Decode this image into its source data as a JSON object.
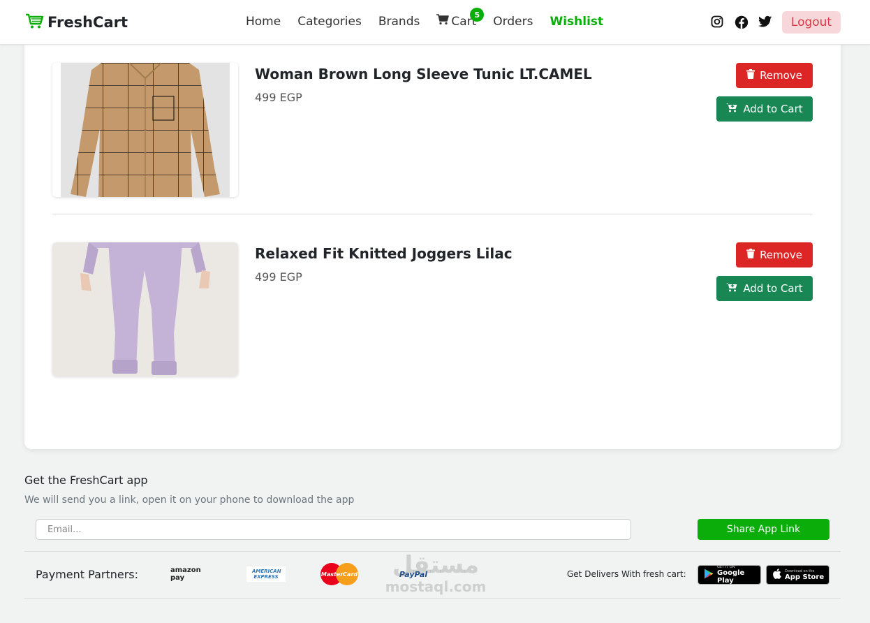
{
  "nav": {
    "brand": "FreshCart",
    "links": [
      {
        "label": "Home"
      },
      {
        "label": "Categories"
      },
      {
        "label": "Brands"
      },
      {
        "label": "Cart",
        "badge": "5"
      },
      {
        "label": "Orders"
      },
      {
        "label": "Wishlist",
        "active": true
      }
    ],
    "socials": [
      "instagram-icon",
      "facebook-icon",
      "twitter-icon"
    ],
    "logout": "Logout"
  },
  "wishlist": {
    "items": [
      {
        "title": "Woman Brown Long Sleeve Tunic LT.CAMEL",
        "price": "499 EGP",
        "remove_label": "Remove",
        "cart_label": "Add to Cart"
      },
      {
        "title": "Relaxed Fit Knitted Joggers Lilac",
        "price": "499 EGP",
        "remove_label": "Remove",
        "cart_label": "Add to Cart"
      }
    ]
  },
  "footer": {
    "title": "Get the FreshCart app",
    "subtitle": "We will send you a link, open it on your phone to download the app",
    "email_placeholder": "Email...",
    "share_label": "Share App Link",
    "payment_label": "Payment Partners:",
    "payment_logos": [
      "amazon pay",
      "AMERICAN EXPRESS",
      "MasterCard",
      "PayPal"
    ],
    "deliver_label": "Get Delivers With fresh cart:",
    "stores": [
      {
        "small": "GET IT ON",
        "big": "Google Play"
      },
      {
        "small": "Download on the",
        "big": "App Store"
      }
    ],
    "watermark": {
      "arabic": "مستقل",
      "latin": "mostaql.com"
    }
  },
  "colors": {
    "brand_green": "#0aad0a",
    "remove_red": "#dc2626",
    "cart_green": "#198754",
    "logout_bg": "#f8d7da",
    "logout_text": "#dc3545"
  }
}
